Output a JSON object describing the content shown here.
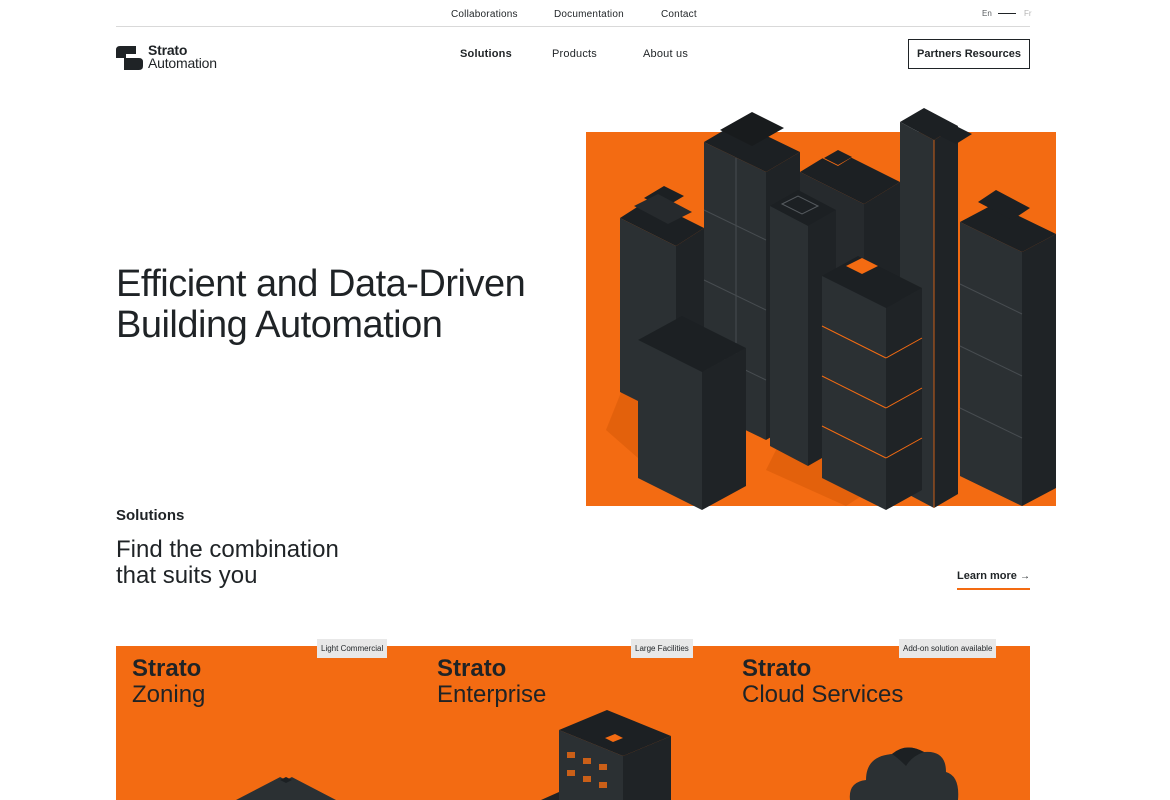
{
  "topbar": {
    "links": [
      "Collaborations",
      "Documentation",
      "Contact"
    ],
    "lang_en": "En",
    "lang_fr": "Fr"
  },
  "logo": {
    "line1": "Strato",
    "line2": "Automation"
  },
  "nav": {
    "items": [
      "Solutions",
      "Products",
      "About us"
    ],
    "active": "Solutions",
    "cta": "Partners Resources"
  },
  "hero": {
    "title_line1": "Efficient and Data-Driven",
    "title_line2": "Building Automation"
  },
  "solutions": {
    "label": "Solutions",
    "subtitle_line1": "Find the combination",
    "subtitle_line2": "that suits you",
    "learn_more": "Learn more",
    "cards": [
      {
        "brand": "Strato",
        "name": "Zoning",
        "badge": "Light Commercial"
      },
      {
        "brand": "Strato",
        "name": "Enterprise",
        "badge": "Large Facilities"
      },
      {
        "brand": "Strato",
        "name": "Cloud Services",
        "badge": "Add-on solution available"
      }
    ]
  },
  "colors": {
    "accent": "#f36b12",
    "dark": "#1f2326",
    "building": "#2b3033"
  },
  "icons": {
    "arrow": "arrow-right-icon",
    "logo_mark": "strato-logo-icon"
  }
}
